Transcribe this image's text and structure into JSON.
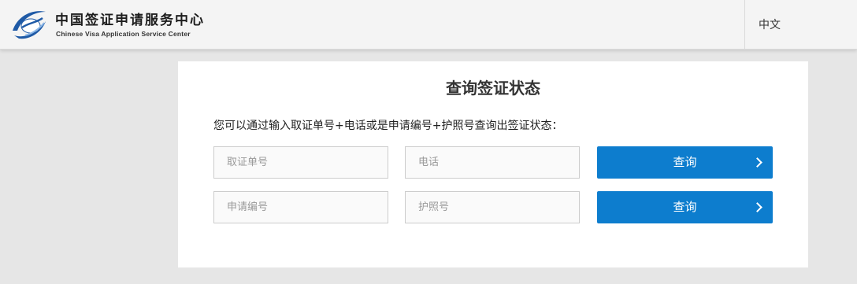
{
  "header": {
    "logo_cn": "中国签证申请服务中心",
    "logo_en": "Chinese Visa Application Service Center",
    "logo_icon": "globe-swoosh-logo",
    "language_label": "中文"
  },
  "form": {
    "title": "查询签证状态",
    "instruction": "您可以通过输入取证单号+电话或是申请编号+护照号查询出签证状态：",
    "row1": {
      "field1_placeholder": "取证单号",
      "field1_value": "",
      "field2_placeholder": "电话",
      "field2_value": "",
      "button_label": "查询",
      "button_icon": "chevron-right-icon"
    },
    "row2": {
      "field1_placeholder": "申请编号",
      "field1_value": "",
      "field2_placeholder": "护照号",
      "field2_value": "",
      "button_label": "查询",
      "button_icon": "chevron-right-icon"
    }
  },
  "colors": {
    "accent": "#0d7dce",
    "background": "#e6e6e6",
    "header_bg": "#f4f4f4",
    "panel_bg": "#ffffff",
    "logo_blue": "#1f5aa6"
  }
}
